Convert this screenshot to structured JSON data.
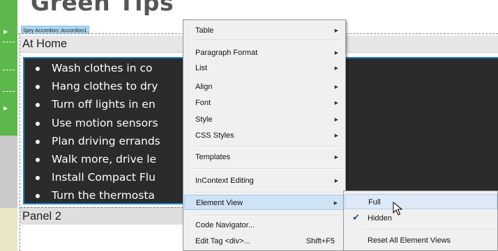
{
  "document": {
    "heading": "Green Tips",
    "tag_label": "Spry Accordion: Accordion1",
    "panel_home_title": "At Home",
    "panel_2_title": "Panel 2",
    "list_items": [
      "Wash clothes in co",
      "Hang clothes to dry",
      "Turn off lights in en",
      "Use motion sensors",
      "Plan driving errands",
      "Walk more, drive le",
      "Install Compact Flu",
      "Turn the thermosta"
    ]
  },
  "context_menu": {
    "items": [
      {
        "label": "Table",
        "submenu": true
      },
      {
        "label": "Paragraph Format",
        "submenu": true
      },
      {
        "label": "List",
        "submenu": true
      },
      {
        "label": "Align",
        "submenu": true
      },
      {
        "label": "Font",
        "submenu": true
      },
      {
        "label": "Style",
        "submenu": true
      },
      {
        "label": "CSS Styles",
        "submenu": true
      },
      {
        "label": "Templates",
        "submenu": true
      },
      {
        "label": "InContext Editing",
        "submenu": true
      },
      {
        "label": "Element View",
        "submenu": true,
        "highlighted": true
      },
      {
        "label": "Code Navigator...",
        "submenu": false
      },
      {
        "label": "Edit Tag <div>...",
        "shortcut": "Shift+F5"
      }
    ]
  },
  "element_view_submenu": {
    "items": [
      {
        "label": "Full",
        "checked": false,
        "highlighted": true
      },
      {
        "label": "Hidden",
        "checked": true
      },
      {
        "label": "Reset All Element Views",
        "checked": false
      }
    ]
  },
  "colors": {
    "gutter_green": "#5cb84a",
    "selection_border": "#1e7fd0",
    "tag_label_bg": "#a8d7f0",
    "menu_bg": "#f0f0f0",
    "menu_highlight": "#cfe3f6"
  }
}
